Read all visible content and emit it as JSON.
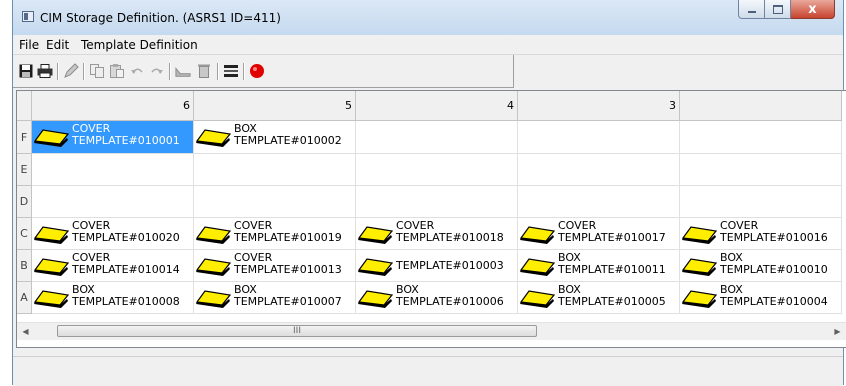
{
  "window": {
    "title": "CIM Storage Definition.  (ASRS1 ID=411)",
    "close_glyph": "x"
  },
  "menu": [
    {
      "label": "File"
    },
    {
      "label": "Edit"
    },
    {
      "label": "Template Definition"
    }
  ],
  "toolbar": {
    "icons": [
      "save-icon",
      "print-icon",
      "edit-icon",
      "copy-icon",
      "paste-icon",
      "undo-icon",
      "redo-icon",
      "tool-icon",
      "delete-icon",
      "list-icon",
      "record-icon"
    ]
  },
  "grid": {
    "columns": [
      "6",
      "5",
      "4",
      "3",
      ""
    ],
    "rows": [
      {
        "label": "F",
        "cells": [
          {
            "line1": "COVER",
            "line2": "TEMPLATE#010001",
            "icon": true,
            "selected": true
          },
          {
            "line1": "BOX",
            "line2": "TEMPLATE#010002",
            "icon": true
          },
          {
            "line1": "",
            "line2": "",
            "icon": false
          },
          {
            "line1": "",
            "line2": "",
            "icon": false
          },
          {
            "line1": "",
            "line2": "",
            "icon": false
          }
        ]
      },
      {
        "label": "E",
        "cells": [
          {
            "line1": "",
            "line2": "",
            "icon": false
          },
          {
            "line1": "",
            "line2": "",
            "icon": false
          },
          {
            "line1": "",
            "line2": "",
            "icon": false
          },
          {
            "line1": "",
            "line2": "",
            "icon": false
          },
          {
            "line1": "",
            "line2": "",
            "icon": false
          }
        ]
      },
      {
        "label": "D",
        "cells": [
          {
            "line1": "",
            "line2": "",
            "icon": false
          },
          {
            "line1": "",
            "line2": "",
            "icon": false
          },
          {
            "line1": "",
            "line2": "",
            "icon": false
          },
          {
            "line1": "",
            "line2": "",
            "icon": false
          },
          {
            "line1": "",
            "line2": "",
            "icon": false
          }
        ]
      },
      {
        "label": "C",
        "cells": [
          {
            "line1": "COVER",
            "line2": "TEMPLATE#010020",
            "icon": true
          },
          {
            "line1": "COVER",
            "line2": "TEMPLATE#010019",
            "icon": true
          },
          {
            "line1": "COVER",
            "line2": "TEMPLATE#010018",
            "icon": true
          },
          {
            "line1": "COVER",
            "line2": "TEMPLATE#010017",
            "icon": true
          },
          {
            "line1": "COVER",
            "line2": "TEMPLATE#010016",
            "icon": true
          }
        ]
      },
      {
        "label": "B",
        "cells": [
          {
            "line1": "COVER",
            "line2": "TEMPLATE#010014",
            "icon": true
          },
          {
            "line1": "COVER",
            "line2": "TEMPLATE#010013",
            "icon": true
          },
          {
            "line1": "",
            "line2": "TEMPLATE#010003",
            "icon": true
          },
          {
            "line1": "BOX",
            "line2": "TEMPLATE#010011",
            "icon": true
          },
          {
            "line1": "BOX",
            "line2": "TEMPLATE#010010",
            "icon": true
          }
        ]
      },
      {
        "label": "A",
        "cells": [
          {
            "line1": "BOX",
            "line2": "TEMPLATE#010008",
            "icon": true
          },
          {
            "line1": "BOX",
            "line2": "TEMPLATE#010007",
            "icon": true
          },
          {
            "line1": "BOX",
            "line2": "TEMPLATE#010006",
            "icon": true
          },
          {
            "line1": "BOX",
            "line2": "TEMPLATE#010005",
            "icon": true
          },
          {
            "line1": "BOX",
            "line2": "TEMPLATE#010004",
            "icon": true
          }
        ]
      }
    ]
  },
  "scrollbar": {
    "left_arrow": "◀",
    "right_arrow": "▶",
    "grip": "III"
  },
  "colors": {
    "selection": "#3399ff",
    "tray_fill": "#ffee00",
    "tray_outline": "#000000",
    "record_red": "#e00000"
  }
}
